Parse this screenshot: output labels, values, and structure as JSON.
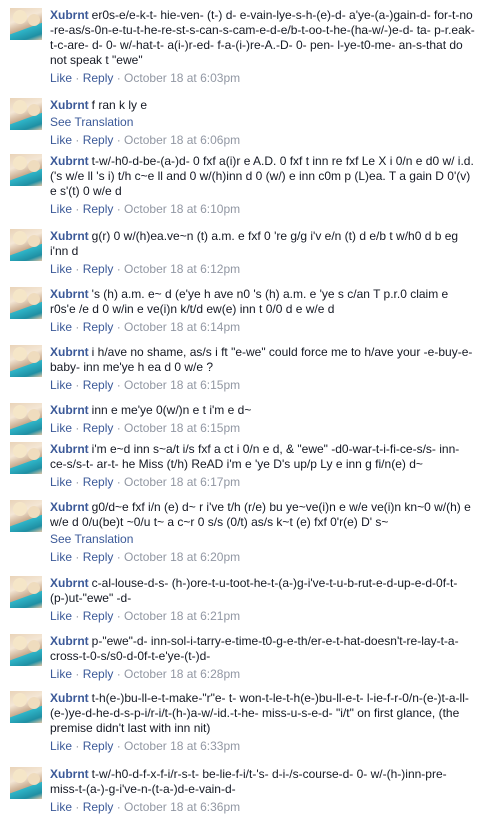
{
  "labels": {
    "like": "Like",
    "reply": "Reply",
    "sep": " · "
  },
  "comments": [
    {
      "author": "Xubrnt",
      "text": "er0s-e/e-k-t- hie-ven- (t-) d- e-vain-lye-s-h-(e)-d- a'ye-(a-)gain-d- for-t-no -re-as/s-0n-e-tu-t-he-re-st-s-can-s-cam-e-d-e/b-t-oo-t-he-(ha-w/-)e-d- ta- p-r.eak-t-c-are- d- 0- w/-hat-t- a(i-)r-ed- f-a-(i-)re-A.-D- 0- pen- l-ye-t0-me- an-s-that do not speak t \"ewe\"",
      "time": "October 18 at 6:03pm"
    },
    {
      "author": "Xubrnt",
      "text": "f ran k ly e",
      "see_translation": "See Translation",
      "time": "October 18 at 6:06pm"
    },
    {
      "author": "Xubrnt",
      "text": "t-w/-h0-d-be-(a-)d- 0 fxf a(i)r e A.D. 0 fxf t inn re fxf Le X i 0/n e d0 w/ i.d. ('s w/e ll 's i) t/h c~e ll and 0 w/(h)inn d 0 (w/) e inn c0m p (L)ea. T a gain D 0'(v) e s'(t) 0 w/e d",
      "time": "October 18 at 6:10pm"
    },
    {
      "author": "Xubrnt",
      "text": "g(r) 0 w/(h)ea.ve~n (t) a.m. e fxf 0 're g/g i'v e/n (t) d e/b t w/h0 d b eg i'nn d",
      "time": "October 18 at 6:12pm"
    },
    {
      "author": "Xubrnt",
      "text": "'s (h) a.m. e~ d (e'ye h ave n0 's (h) a.m. e 'ye s c/an T p.r.0 claim e r0s'e /e d 0 w/in e ve(i)n k/t/d ew(e) inn t 0/0 d e w/e d",
      "time": "October 18 at 6:14pm"
    },
    {
      "author": "Xubrnt",
      "text": "i h/ave no shame, as/s i ft \"e-we\" could force me to h/ave your -e-buy-e-baby- inn me'ye h ea d 0 w/e ?",
      "time": "October 18 at 6:15pm"
    },
    {
      "author": "Xubrnt",
      "text": "inn e me'ye 0(w/)n e t i'm e d~",
      "time": "October 18 at 6:15pm"
    },
    {
      "author": "Xubrnt",
      "text": "i'm e~d inn s~a/t i/s fxf a ct i 0/n e d, & \"ewe\" -d0-war-t-i-fi-ce-s/s- inn-ce-s/s-t- ar-t- he Miss (t/h) ReAD i'm e 'ye D's up/p Ly e inn g fi/n(e) d~",
      "time": "October 18 at 6:17pm"
    },
    {
      "author": "Xubrnt",
      "text": "g0/d~e fxf i/n (e) d~ r i've t/h (r/e) bu ye~ve(i)n e w/e ve(i)n kn~0 w/(h) e w/e d 0/u(be)t ~0/u t~ a c~r 0 s/s (0/t) as/s k~t (e) fxf 0'r(e) D' s~",
      "see_translation": "See Translation",
      "time": "October 18 at 6:20pm"
    },
    {
      "author": "Xubrnt",
      "text": "c-al-louse-d-s- (h-)ore-t-u-toot-he-t-(a-)g-i've-t-u-b-rut-e-d-up-e-d-0f-t-(p-)ut-\"ewe\" -d-",
      "time": "October 18 at 6:21pm"
    },
    {
      "author": "Xubrnt",
      "text": "p-\"ewe\"-d- inn-sol-i-tarry-e-time-t0-g-e-th/er-e-t-hat-doesn't-re-lay-t-a-cross-t-0-s/s0-d-0f-t-e'ye-(t-)d-",
      "time": "October 18 at 6:28pm"
    },
    {
      "author": "Xubrnt",
      "text": "t-h(e-)bu-ll-e-t-make-\"r\"e- t- won-t-le-t-h(e-)bu-ll-e-t- l-ie-f-r-0/n-(e-)t-a-ll-(e-)ye-d-he-d-s-p-i/r-i/t-(h-)a-w/-id.-t-he- miss-u-s-e-d- \"i/t\" on first glance, (the premise didn't last with inn nit)",
      "time": "October 18 at 6:33pm"
    },
    {
      "author": "Xubrnt",
      "text": "t-w/-h0-d-f-x-f-i/r-s-t- be-lie-f-i/t-'s- d-i-/s-course-d- 0- w/-(h-)inn-pre-miss-t-(a-)-g-i've-n-(t-a-)d-e-vain-d-",
      "time": "October 18 at 6:36pm"
    }
  ]
}
